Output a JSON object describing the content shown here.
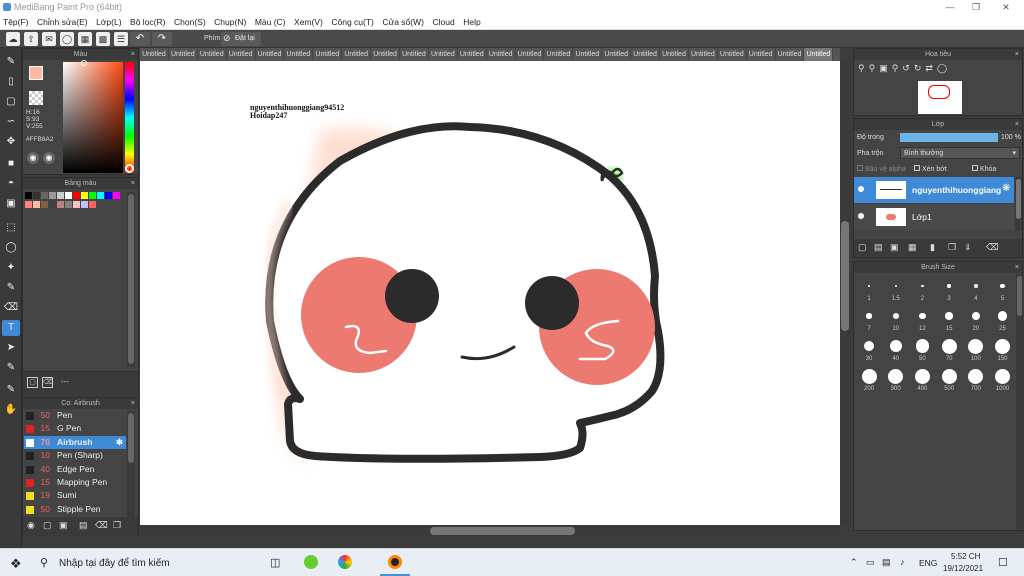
{
  "app": {
    "title": "MediBang Paint Pro (64bit)"
  },
  "menu": [
    "Tệp(F)",
    "Chỉnh sửa(E)",
    "Lớp(L)",
    "Bộ lọc(R)",
    "Chọn(S)",
    "Chụp(N)",
    "Màu (C)",
    "Xem(V)",
    "Công cụ(T)",
    "Cửa sổ(W)",
    "Cloud",
    "Help"
  ],
  "toolbar": {
    "phim_label": "Phím",
    "reset_label": "Đặt lại"
  },
  "tabs": [
    "Untitled",
    "Untitled",
    "Untitled",
    "Untitled",
    "Untitled",
    "Untitled",
    "Untitled",
    "Untitled",
    "Untitled",
    "Untitled",
    "Untitled",
    "Untitled",
    "Untitled",
    "Untitled",
    "Untitled",
    "Untitled",
    "Untitled",
    "Untitled",
    "Untitled",
    "Untitled",
    "Untitled",
    "Untitled",
    "Untitled",
    "Untitled"
  ],
  "color_panel": {
    "title": "Màu",
    "h": "H:16",
    "s": "S:93",
    "v": "V:255",
    "hex": "#FFB8A2",
    "fg": "#FFB8A2",
    "bg": "#000000"
  },
  "palette_panel": {
    "title": "Bảng màu",
    "footer": "---"
  },
  "palette_colors": [
    "#000000",
    "#333333",
    "#666666",
    "#999999",
    "#cccccc",
    "#ffffff",
    "#ff0000",
    "#ffff00",
    "#00ff00",
    "#00ffff",
    "#0000ff",
    "#ff00ff",
    "#ff8080",
    "#ffb8a2",
    "#806040",
    "#404040",
    "#c08080",
    "#808080",
    "#ffc0c0",
    "#c0c0ff",
    "#ff6060"
  ],
  "brush_panel": {
    "title": "Cọ: Airbrush"
  },
  "brushes": [
    {
      "size": "50",
      "name": "Pen",
      "color": "#222222"
    },
    {
      "size": "15",
      "name": "G Pen",
      "color": "#e02020"
    },
    {
      "size": "70",
      "name": "Airbrush",
      "color": "#ffffff"
    },
    {
      "size": "10",
      "name": "Pen (Sharp)",
      "color": "#222222"
    },
    {
      "size": "40",
      "name": "Edge Pen",
      "color": "#222222"
    },
    {
      "size": "15",
      "name": "Mapping Pen",
      "color": "#e02020"
    },
    {
      "size": "19",
      "name": "Sumi",
      "color": "#f0e020"
    },
    {
      "size": "50",
      "name": "Stipple Pen",
      "color": "#f0e020"
    }
  ],
  "canvas": {
    "watermark_line1": "nguyenthihuonggiang94512",
    "watermark_line2": "Hoidap247"
  },
  "navigator": {
    "title": "Hoa tiêu"
  },
  "layer_panel": {
    "title": "Lớp",
    "opacity_label": "Độ trong",
    "opacity_value": "100 %",
    "opacity_fraction": 1.0,
    "blend_label": "Pha trộn",
    "blend_value": "Bình thường",
    "protect_alpha": "Bảo vệ alpha",
    "clipping": "Xén bớt",
    "lock": "Khóa",
    "layers": [
      {
        "name": "nguyenthihuonggiang"
      },
      {
        "name": "Lớp1"
      }
    ]
  },
  "brush_size_panel": {
    "title": "Brush Size",
    "sizes": [
      "1",
      "1.5",
      "2",
      "3",
      "4",
      "5",
      "7",
      "10",
      "12",
      "15",
      "20",
      "25",
      "30",
      "40",
      "50",
      "70",
      "100",
      "150",
      "200",
      "300",
      "400",
      "500",
      "700",
      "1000"
    ]
  },
  "taskbar": {
    "search_placeholder": "Nhập tại đây để tìm kiếm",
    "lang": "ENG",
    "time": "5:52 CH",
    "date": "19/12/2021"
  }
}
